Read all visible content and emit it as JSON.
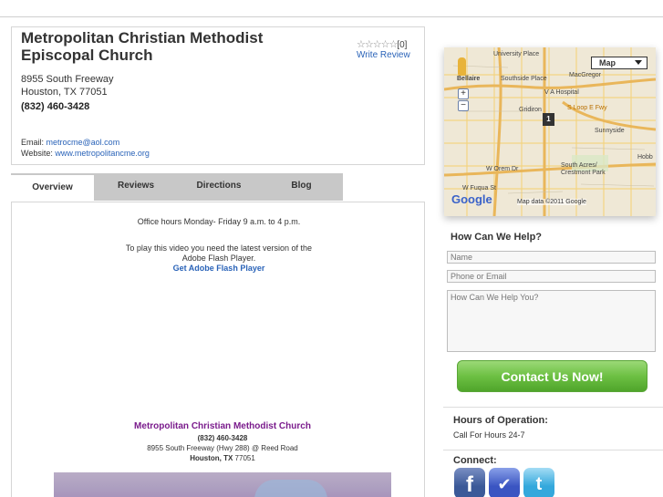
{
  "listing": {
    "name": "Metropolitan Christian Methodist Episcopal Church",
    "address_line1": "8955 South Freeway",
    "address_line2": "Houston, TX 77051",
    "phone": "(832) 460-3428",
    "email_label": "Email:",
    "email": "metrocme@aol.com",
    "website_label": "Website:",
    "website": "www.metropolitancme.org",
    "rating_stars": "☆☆☆☆☆",
    "rating_count": "[0]",
    "write_review": "Write Review"
  },
  "tabs": [
    {
      "label": "Overview",
      "active": true
    },
    {
      "label": "Reviews",
      "active": false
    },
    {
      "label": "Directions",
      "active": false
    },
    {
      "label": "Blog",
      "active": false
    }
  ],
  "overview": {
    "office_hours": "Office hours Monday- Friday 9 a.m. to 4 p.m.",
    "flash_line1": "To play this video you need the latest version of the",
    "flash_line2": "Adobe Flash Player.",
    "flash_link": "Get Adobe Flash Player",
    "church_title": "Metropolitan Christian Methodist Church",
    "church_phone": "(832) 460-3428",
    "church_address": "8955 South Freeway (Hwy 288) @ Reed Road",
    "church_city_bold": "Houston, TX",
    "church_zip": "77051"
  },
  "map": {
    "type_select": "Map",
    "zoom_in": "+",
    "zoom_out": "−",
    "marker_label": "1",
    "labels": [
      "University Place",
      "Bellaire",
      "Southside Place",
      "MacGregor",
      "V A Hospital",
      "Gridiron",
      "S Loop E Fwy",
      "Sunnyside",
      "W Orem Dr",
      "South Acres/ Crestmont Park",
      "W Fuqua St",
      "Hobb"
    ],
    "shields": [
      "610",
      "610",
      "35",
      "35",
      "288"
    ],
    "google": "Google",
    "attribution": "Map data ©2011 Google"
  },
  "help_form": {
    "title": "How Can We Help?",
    "name_placeholder": "Name",
    "contact_placeholder": "Phone or Email",
    "message_placeholder": "How Can We Help You?",
    "submit_label": "Contact Us Now!"
  },
  "hours": {
    "title": "Hours of Operation:",
    "text": "Call For Hours 24-7"
  },
  "connect": {
    "title": "Connect:",
    "icons": [
      "facebook-icon",
      "checkin-icon",
      "twitter-icon"
    ]
  },
  "colors": {
    "link": "#2a63b8",
    "church_title": "#7a1b8c",
    "button_green": "#6dc043",
    "tab_bar": "#c8c8c8"
  }
}
